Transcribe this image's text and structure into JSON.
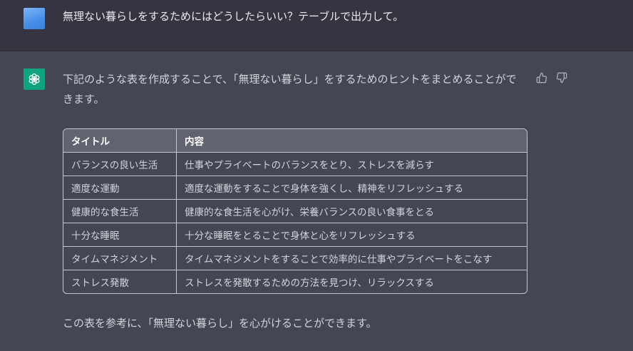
{
  "user_message": {
    "text": "無理ない暮らしをするためにはどうしたらいい？テーブルで出力して。"
  },
  "assistant_message": {
    "intro": "下記のような表を作成することで、「無理ない暮らし」をするためのヒントをまとめることができます。",
    "table": {
      "headers": [
        "タイトル",
        "内容"
      ],
      "rows": [
        [
          "バランスの良い生活",
          "仕事やプライベートのバランスをとり、ストレスを減らす"
        ],
        [
          "適度な運動",
          "適度な運動をすることで身体を強くし、精神をリフレッシュする"
        ],
        [
          "健康的な食生活",
          "健康的な食生活を心がけ、栄養バランスの良い食事をとる"
        ],
        [
          "十分な睡眠",
          "十分な睡眠をとることで身体と心をリフレッシュする"
        ],
        [
          "タイムマネジメント",
          "タイムマネジメントをすることで効率的に仕事やプライベートをこなす"
        ],
        [
          "ストレス発散",
          "ストレスを発散するための方法を見つけ、リラックスする"
        ]
      ]
    },
    "outro": "この表を参考に、「無理ない暮らし」を心がけることができます。"
  },
  "icons": {
    "user_avatar": "user-avatar",
    "bot_avatar": "openai-logo-icon",
    "thumbs_up": "thumbs-up-icon",
    "thumbs_down": "thumbs-down-icon"
  },
  "colors": {
    "page_bg": "#444654",
    "user_row_bg": "#343541",
    "bot_avatar_bg": "#10a37f",
    "table_header_bg": "#626370"
  }
}
